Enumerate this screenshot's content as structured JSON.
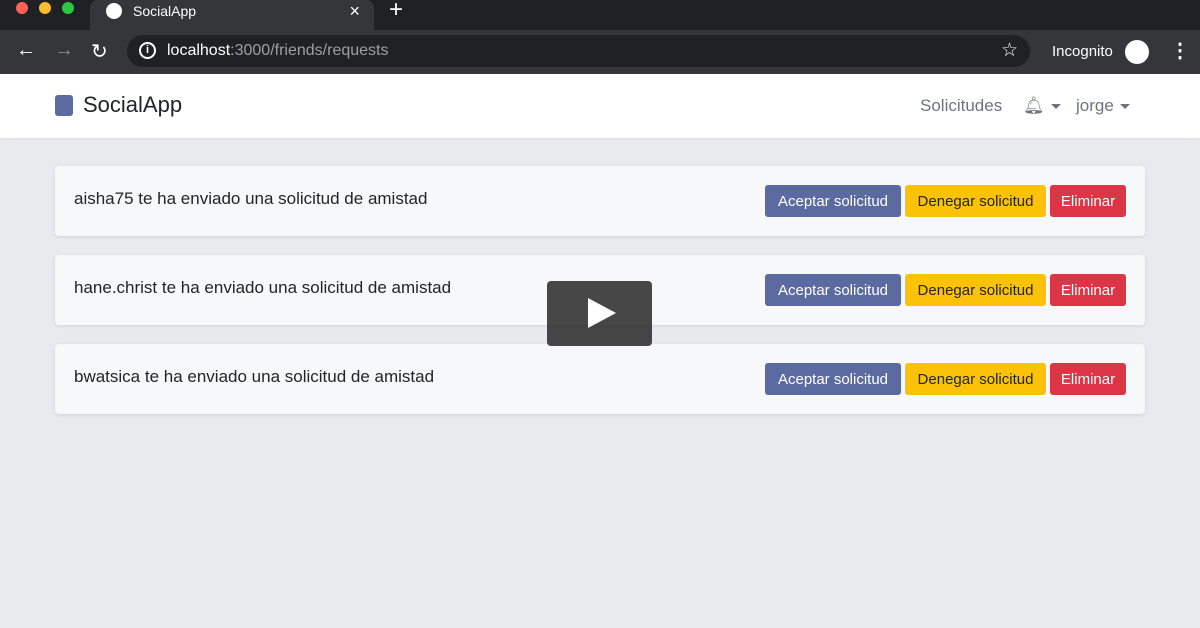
{
  "browser": {
    "tab_title": "SocialApp",
    "url_host": "localhost",
    "url_rest": ":3000/friends/requests",
    "profile": "Incognito"
  },
  "navbar": {
    "brand": "SocialApp",
    "requests_link": "Solicitudes",
    "user": "jorge"
  },
  "requests": [
    {
      "message": "aisha75 te ha enviado una solicitud de amistad"
    },
    {
      "message": "hane.christ te ha enviado una solicitud de amistad"
    },
    {
      "message": "bwatsica te ha enviado una solicitud de amistad"
    }
  ],
  "buttons": {
    "accept": "Aceptar solicitud",
    "deny": "Denegar solicitud",
    "delete": "Eliminar"
  },
  "colors": {
    "primary": "#5b6aa0",
    "warning": "#fcc208",
    "danger": "#dc3545"
  }
}
